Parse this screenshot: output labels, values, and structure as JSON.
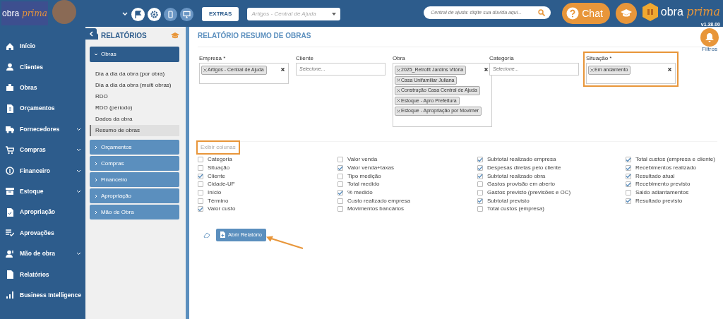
{
  "header": {
    "logo": {
      "word1": "obra",
      "word2": "prima"
    },
    "extras_button": "EXTRAS",
    "article_select": {
      "value": "Artigos - Central de Ajuda"
    },
    "help_search": {
      "placeholder": "Central de ajuda: digite sua dúvida aqui..."
    },
    "chat_button": "Chat",
    "brand": {
      "word1": "obra",
      "word2": "prima"
    },
    "version": "v1.38.00"
  },
  "sidebar": {
    "items": [
      {
        "label": "Início",
        "expandable": false
      },
      {
        "label": "Clientes",
        "expandable": false
      },
      {
        "label": "Obras",
        "expandable": false
      },
      {
        "label": "Orçamentos",
        "expandable": false
      },
      {
        "label": "Fornecedores",
        "expandable": true
      },
      {
        "label": "Compras",
        "expandable": true
      },
      {
        "label": "Financeiro",
        "expandable": true
      },
      {
        "label": "Estoque",
        "expandable": true
      },
      {
        "label": "Apropriação",
        "expandable": false
      },
      {
        "label": "Aprovações",
        "expandable": false
      },
      {
        "label": "Mão de obra",
        "expandable": true
      },
      {
        "label": "Relatórios",
        "expandable": false
      },
      {
        "label": "Business Intelligence",
        "expandable": false
      }
    ]
  },
  "reports_panel": {
    "title": "RELATÓRIOS",
    "groups": [
      {
        "label": "Obras",
        "expanded": true,
        "children": [
          {
            "label": "Dia a dia da obra (por obra)",
            "selected": false
          },
          {
            "label": "Dia a dia da obra (multi obras)",
            "selected": false
          },
          {
            "label": "RDO",
            "selected": false
          },
          {
            "label": "RDO (período)",
            "selected": false
          },
          {
            "label": "Dados da obra",
            "selected": false
          },
          {
            "label": "Resumo de obras",
            "selected": true
          }
        ]
      },
      {
        "label": "Orçamentos",
        "expanded": false
      },
      {
        "label": "Compras",
        "expanded": false
      },
      {
        "label": "Financeiro",
        "expanded": false
      },
      {
        "label": "Apropriação",
        "expanded": false
      },
      {
        "label": "Mão de Obra",
        "expanded": false
      }
    ]
  },
  "main": {
    "title": "RELATÓRIO RESUMO DE OBRAS",
    "filters_button": "Filtros",
    "filters": [
      {
        "label": "Empresa *",
        "tags": [
          "Artigos - Central de Ajuda"
        ],
        "highlighted": false
      },
      {
        "label": "Cliente",
        "placeholder": "Selecione...",
        "highlighted": false
      },
      {
        "label": "Obra",
        "tags": [
          "2025_Retrofit Jardins Vitória",
          "Casa Unifamiliar Juliana",
          "Construção Casa Central de Ajuda",
          "Estoque - Apro Prefeitura",
          "Estoque - Apropriação por Movimer"
        ],
        "highlighted": false
      },
      {
        "label": "Categoria",
        "placeholder": "Selecione...",
        "highlighted": false
      },
      {
        "label": "Situação *",
        "tags": [
          "Em andamento"
        ],
        "highlighted": true
      }
    ],
    "columns": {
      "legend": "Exibir colunas",
      "highlighted": true,
      "groups": [
        {
          "items": [
            {
              "label": "Categoria",
              "checked": false
            },
            {
              "label": "Situação",
              "checked": false
            },
            {
              "label": "Cliente",
              "checked": true
            },
            {
              "label": "Cidade-UF",
              "checked": false
            },
            {
              "label": "Início",
              "checked": false
            },
            {
              "label": "Término",
              "checked": false
            },
            {
              "label": "Valor custo",
              "checked": true
            }
          ]
        },
        {
          "items": [
            {
              "label": "Valor venda",
              "checked": false
            },
            {
              "label": "Valor venda+taxas",
              "checked": true
            },
            {
              "label": "Tipo medição",
              "checked": false
            },
            {
              "label": "Total medido",
              "checked": false
            },
            {
              "label": "% medido",
              "checked": true
            },
            {
              "label": "Custo realizado empresa",
              "checked": false
            },
            {
              "label": "Movimentos bancários",
              "checked": false
            }
          ]
        },
        {
          "items": [
            {
              "label": "Subtotal realizado empresa",
              "checked": true
            },
            {
              "label": "Despesas diretas pelo cliente",
              "checked": true
            },
            {
              "label": "Subtotal realizado obra",
              "checked": true
            },
            {
              "label": "Gastos provisão em aberto",
              "checked": false
            },
            {
              "label": "Gastos previsto (previsões e OC)",
              "checked": false
            },
            {
              "label": "Subtotal previsto",
              "checked": true
            },
            {
              "label": "Total custos (empresa)",
              "checked": false
            }
          ]
        },
        {
          "items": [
            {
              "label": "Total custos (empresa e cliente)",
              "checked": true
            },
            {
              "label": "Recebimentos realizado",
              "checked": true
            },
            {
              "label": "Resultado atual",
              "checked": true
            },
            {
              "label": "Recebimento previsto",
              "checked": true
            },
            {
              "label": "Saldo adiantamentos",
              "checked": false
            },
            {
              "label": "Resultado previsto",
              "checked": true
            }
          ]
        }
      ]
    },
    "open_report_button": "Abrir Relatório"
  }
}
